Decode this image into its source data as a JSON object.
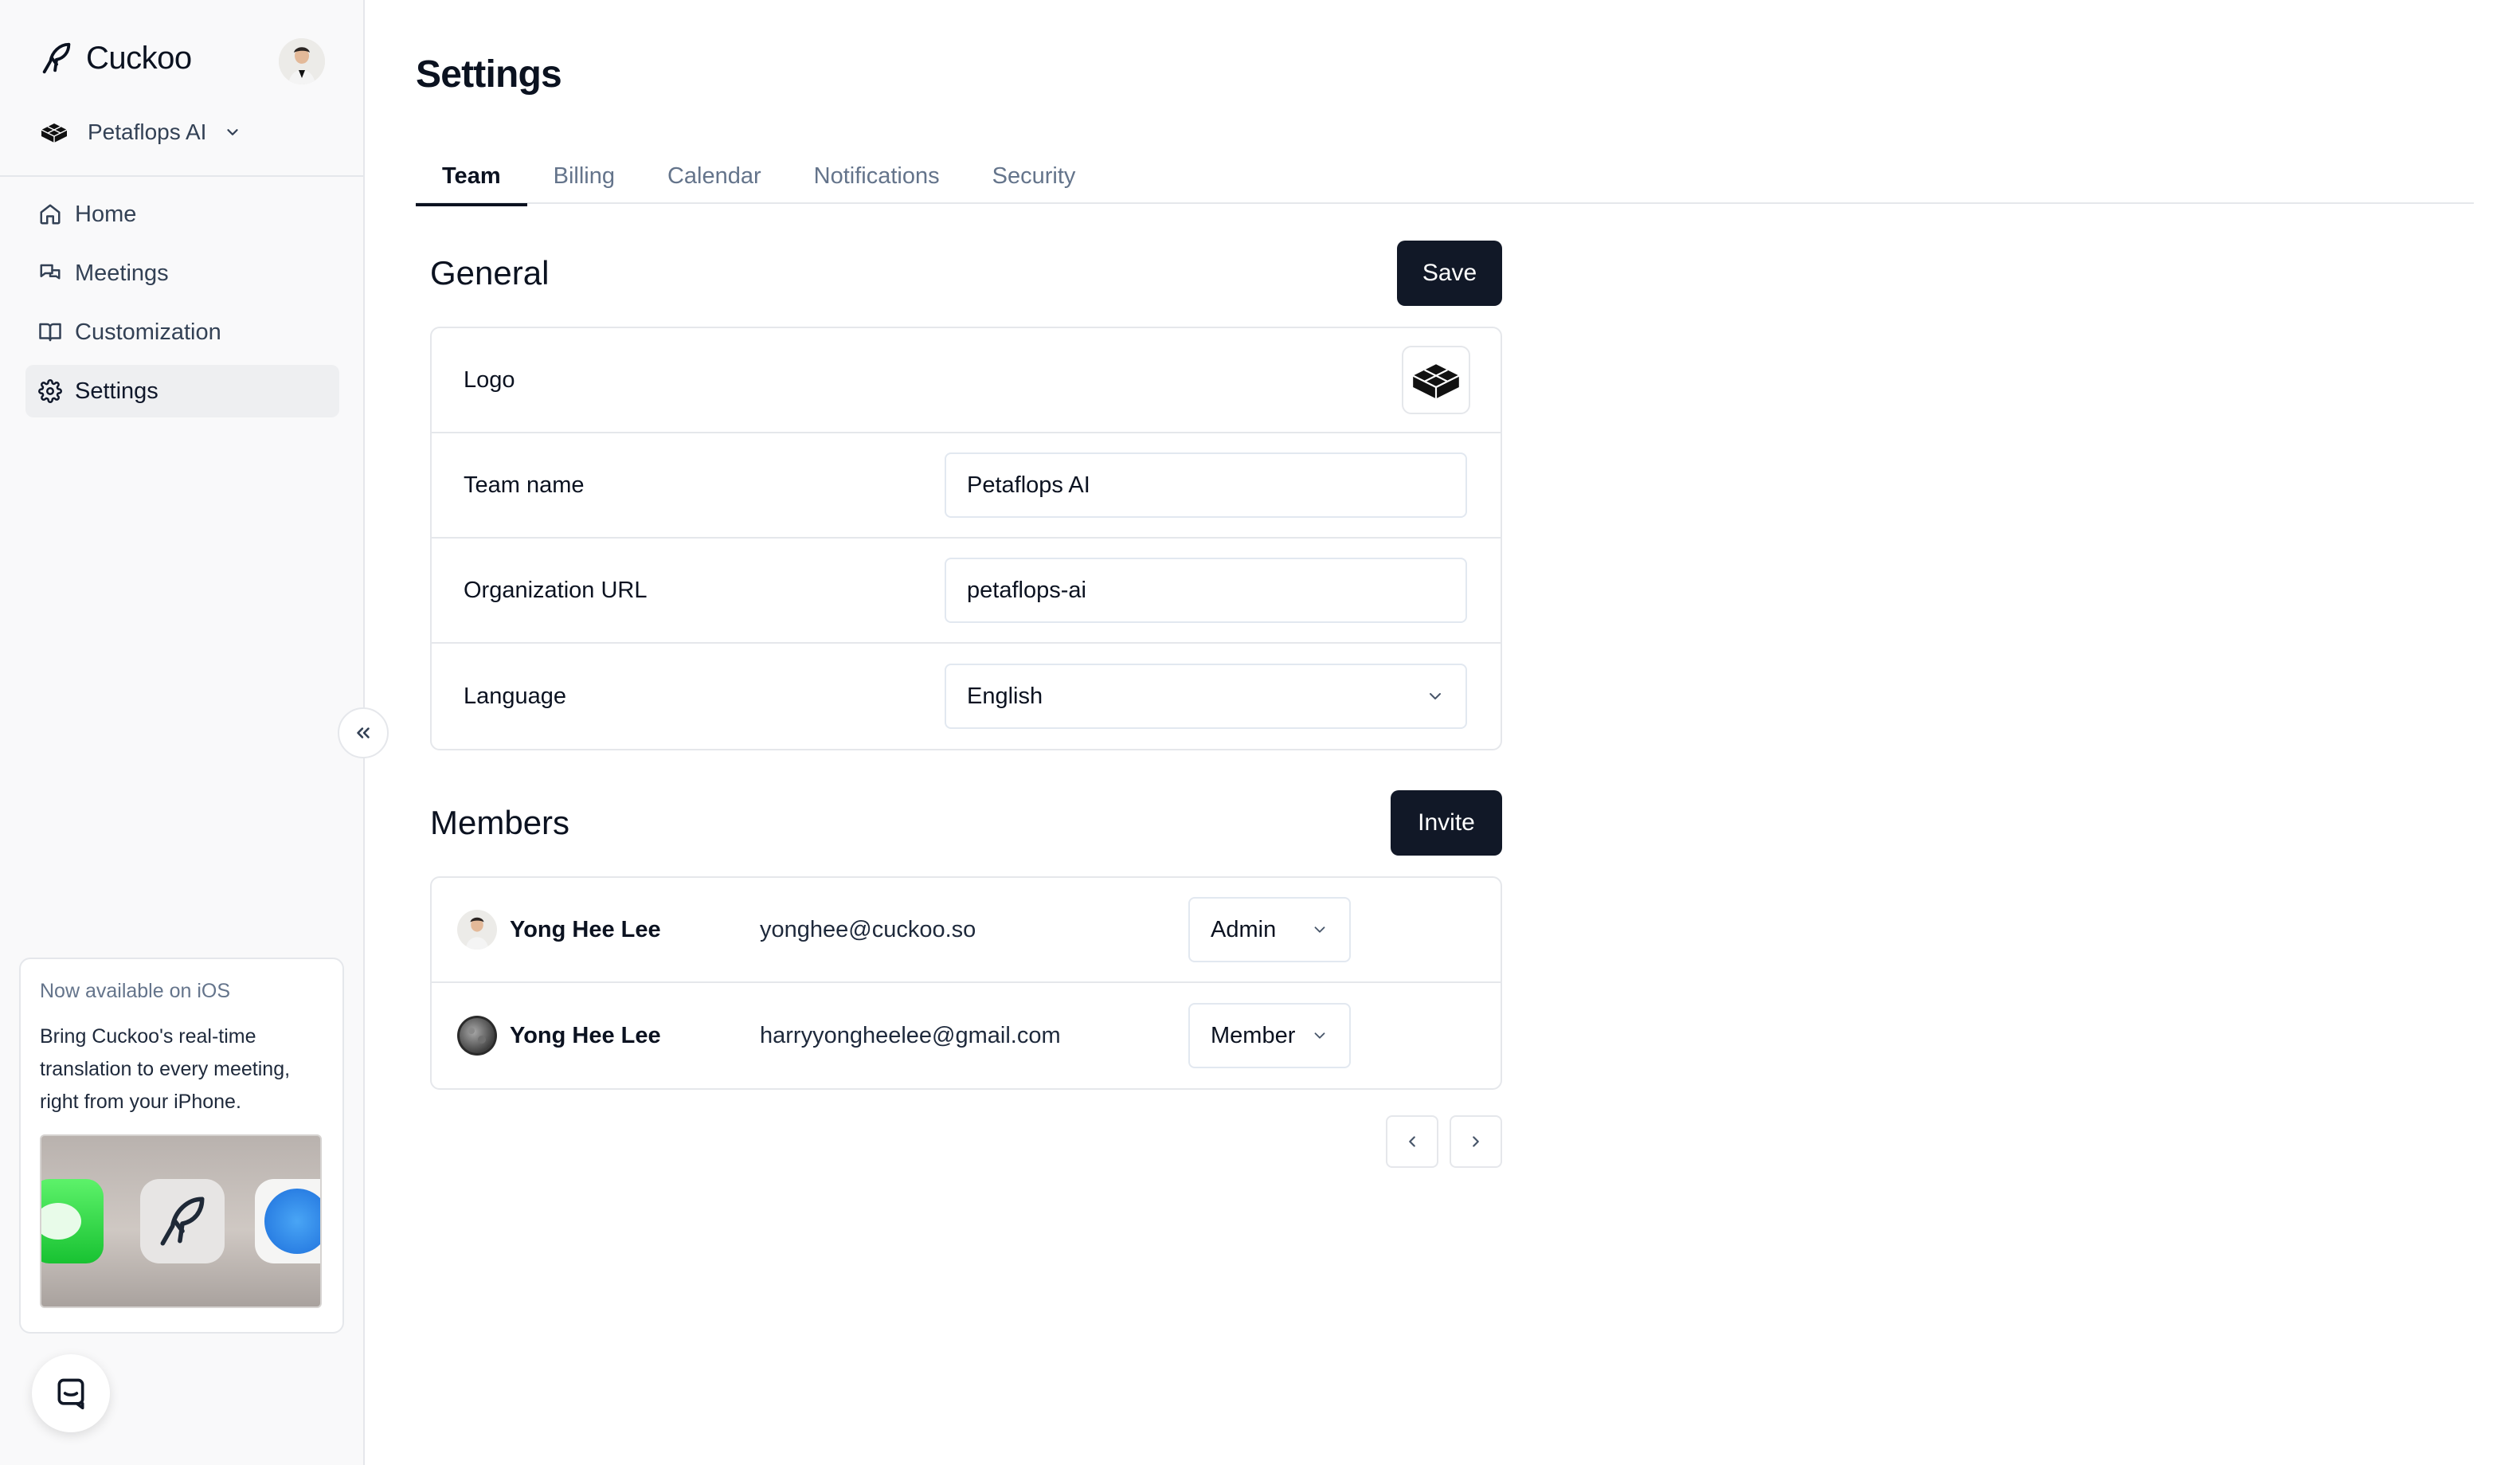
{
  "app": {
    "name": "Cuckoo"
  },
  "org": {
    "name": "Petaflops AI"
  },
  "nav": [
    {
      "label": "Home",
      "icon": "home-icon"
    },
    {
      "label": "Meetings",
      "icon": "chat-bubbles-icon"
    },
    {
      "label": "Customization",
      "icon": "book-icon"
    },
    {
      "label": "Settings",
      "icon": "gear-icon",
      "active": true
    }
  ],
  "promo": {
    "title": "Now available on iOS",
    "text": "Bring Cuckoo's real-time translation to every meeting, right from your iPhone."
  },
  "page": {
    "title": "Settings"
  },
  "tabs": [
    {
      "label": "Team",
      "active": true
    },
    {
      "label": "Billing"
    },
    {
      "label": "Calendar"
    },
    {
      "label": "Notifications"
    },
    {
      "label": "Security"
    }
  ],
  "general": {
    "title": "General",
    "save_label": "Save",
    "logo_label": "Logo",
    "team_name_label": "Team name",
    "team_name_value": "Petaflops AI",
    "org_url_label": "Organization URL",
    "org_url_value": "petaflops-ai",
    "language_label": "Language",
    "language_value": "English"
  },
  "members": {
    "title": "Members",
    "invite_label": "Invite",
    "rows": [
      {
        "name": "Yong Hee Lee",
        "email": "yonghee@cuckoo.so",
        "role": "Admin"
      },
      {
        "name": "Yong Hee Lee",
        "email": "harryyongheelee@gmail.com",
        "role": "Member"
      }
    ]
  },
  "colors": {
    "primary_button": "#111827",
    "border": "#e5e7eb",
    "sidebar_bg": "#f9f9fa"
  }
}
